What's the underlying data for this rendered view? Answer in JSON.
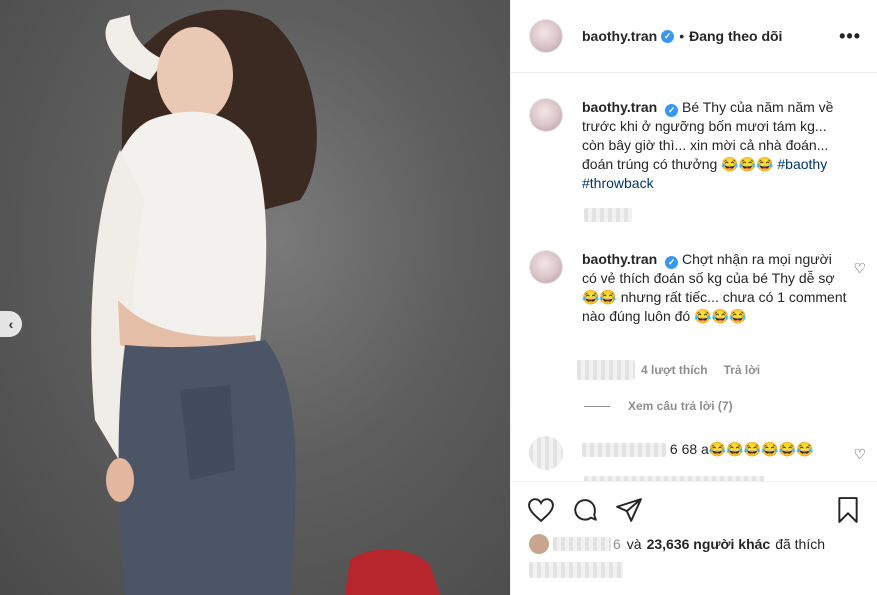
{
  "header": {
    "username": "baothy.tran",
    "separator": "•",
    "follow_status": "Đang theo dõi",
    "more_label": "•••"
  },
  "caption": {
    "username": "baothy.tran",
    "text": "Bé Thy của năm năm về trước khi ở ngưỡng bốn mươi tám kg... còn bây giờ thì... xin mời cả nhà đoán... đoán trúng có thưởng 😂😂😂",
    "tags": [
      "#baothy",
      "#throwback"
    ]
  },
  "comments": [
    {
      "username": "baothy.tran",
      "text": "Chợt nhận ra mọi người có vẻ thích đoán số kg của bé Thy dễ sợ 😂😂 nhưng rất tiếc... chưa có 1 comment nào đúng luôn đó 😂😂😂",
      "likes_label": "4 lượt thích",
      "reply_label": "Trả lời",
      "view_replies": "Xem câu trả lời (7)"
    },
    {
      "username": "",
      "text": "6 68 a😂😂😂😂😂😂"
    }
  ],
  "liked_by": {
    "count_prefix": "6",
    "text_mid": "và",
    "others": "23,636 người khác",
    "suffix": "đã thích"
  },
  "photo": {
    "prev_arrow": "‹"
  },
  "colors": {
    "verified": "#3897f0",
    "hashtag": "#003569",
    "muted": "#8e8e8e"
  },
  "icons": [
    "heart-icon",
    "comment-icon",
    "share-icon",
    "bookmark-icon",
    "verified-badge-icon",
    "more-options-icon",
    "chevron-left-icon"
  ]
}
